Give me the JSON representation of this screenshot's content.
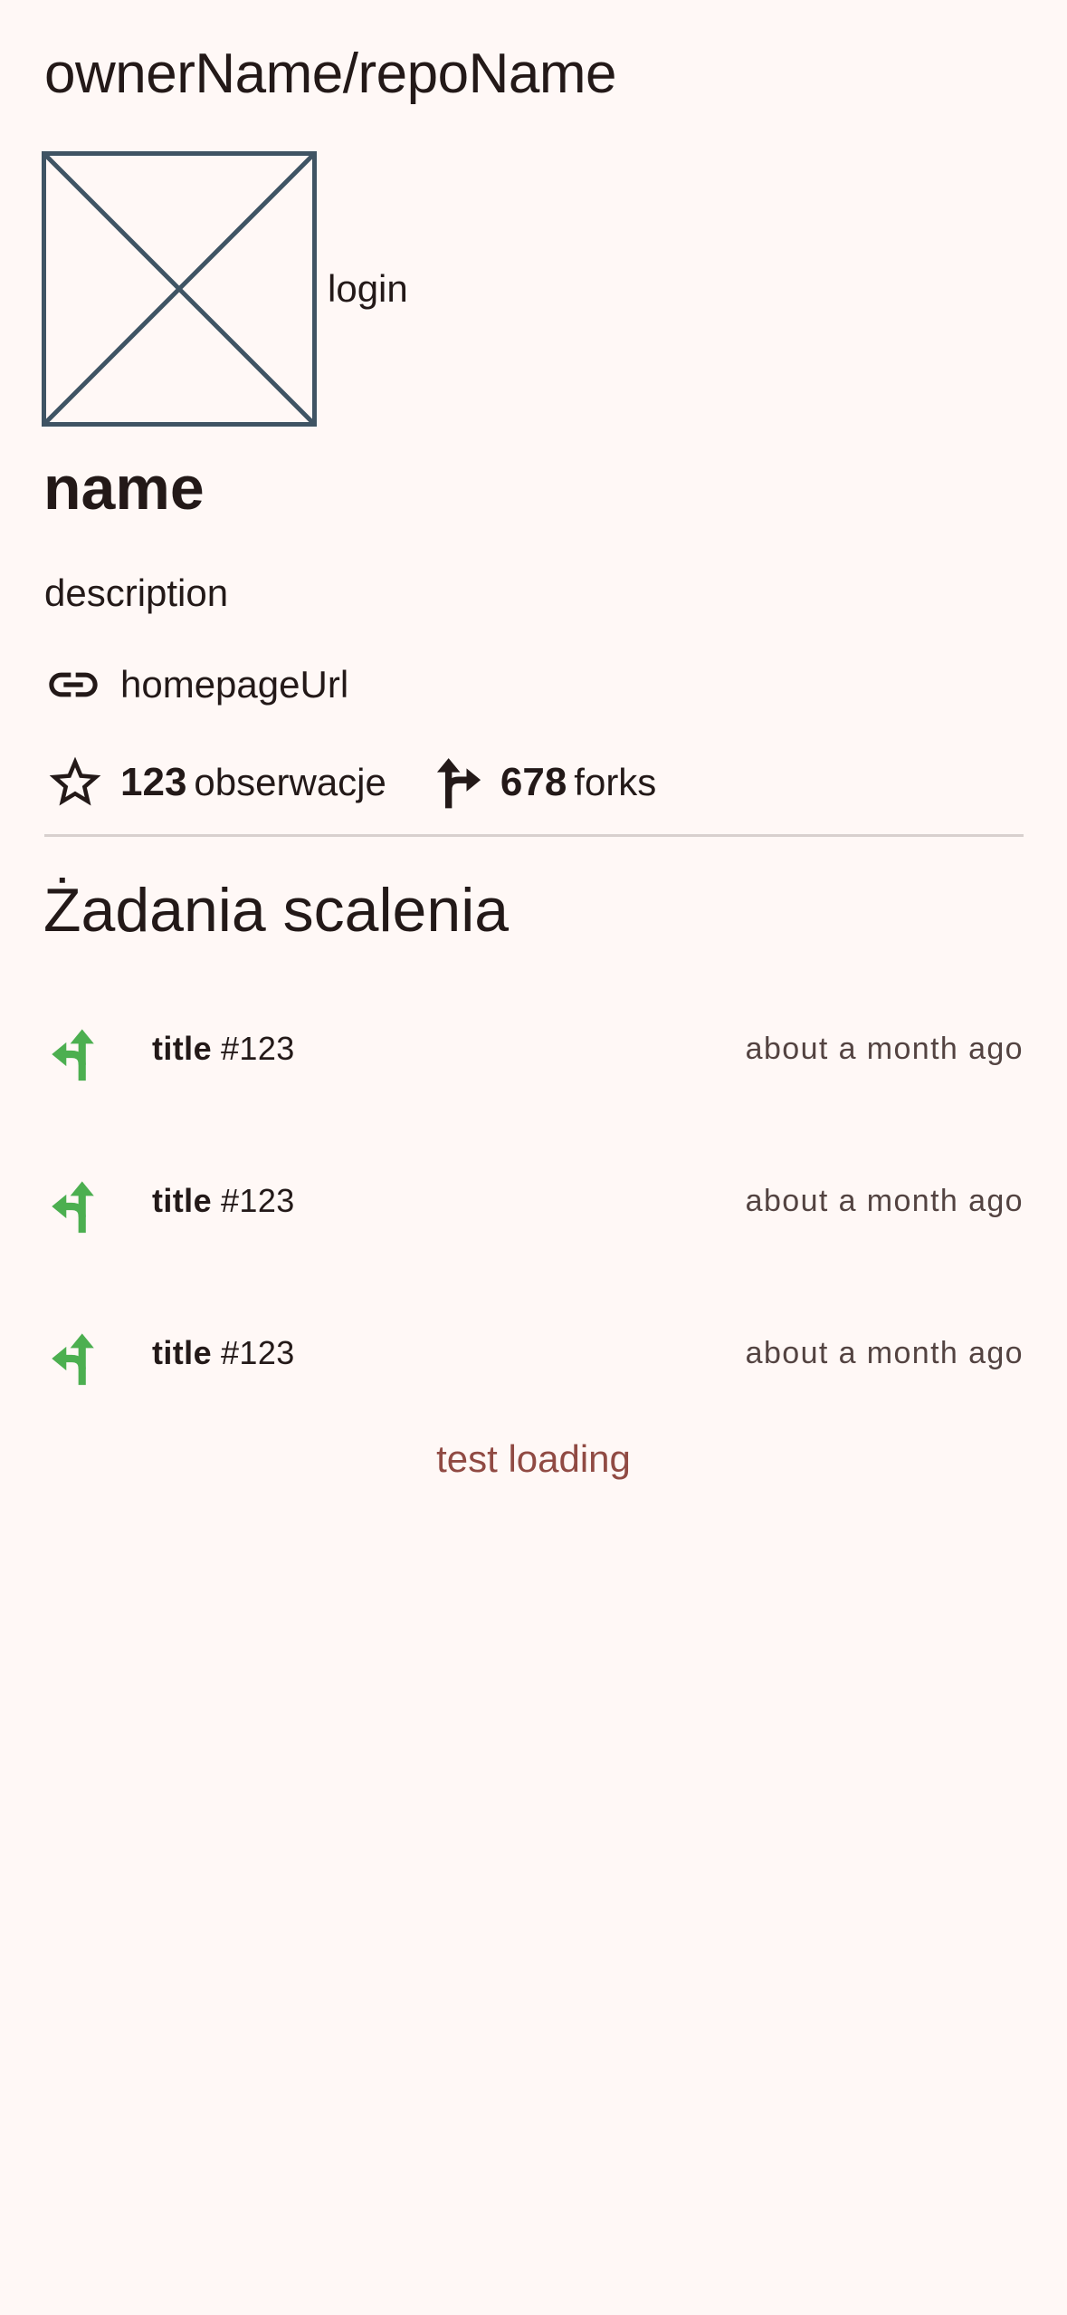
{
  "header": {
    "repo_title": "ownerName/repoName"
  },
  "owner": {
    "login": "login",
    "avatar_icon": "broken-image-placeholder"
  },
  "repo": {
    "name": "name",
    "description": "description",
    "homepage_url": "homepageUrl",
    "link_icon": "link-icon"
  },
  "stats": {
    "watchers_count": "123",
    "watchers_label": "obserwacje",
    "watchers_icon": "star-icon",
    "forks_count": "678",
    "forks_label": "forks",
    "forks_icon": "fork-icon"
  },
  "pull_requests": {
    "section_title": "Żadania scalenia",
    "icon": "merge-icon",
    "icon_color": "#4caf50",
    "items": [
      {
        "title": "title",
        "number": "#123",
        "time": "about a month ago"
      },
      {
        "title": "title",
        "number": "#123",
        "time": "about a month ago"
      },
      {
        "title": "title",
        "number": "#123",
        "time": "about a month ago"
      }
    ],
    "loading_text": "test loading",
    "loading_color": "#904a43"
  }
}
